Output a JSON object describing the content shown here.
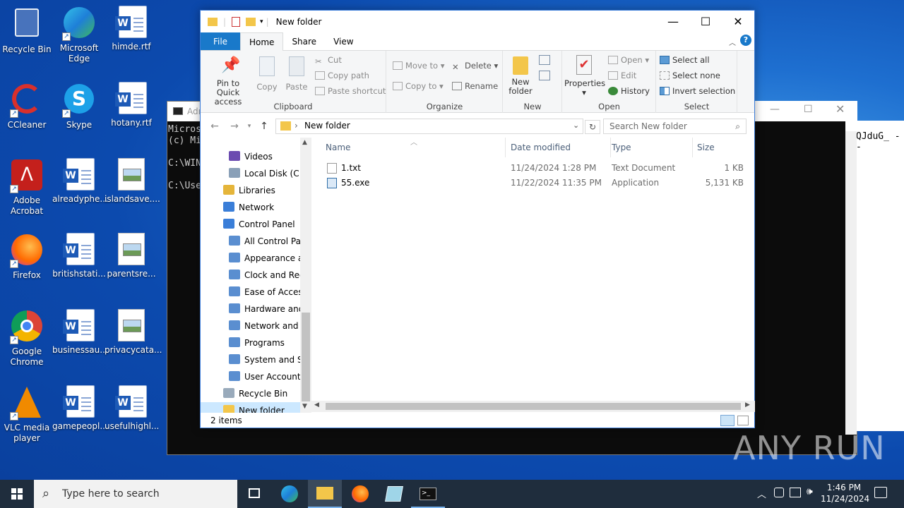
{
  "desktop": {
    "icons": [
      {
        "label": "Recycle Bin",
        "type": "recycle"
      },
      {
        "label": "Microsoft Edge",
        "type": "edge"
      },
      {
        "label": "himde.rtf",
        "type": "word"
      },
      {
        "label": "CCleaner",
        "type": "ccleaner"
      },
      {
        "label": "Skype",
        "type": "skype"
      },
      {
        "label": "hotany.rtf",
        "type": "word"
      },
      {
        "label": "Adobe Acrobat",
        "type": "acrobat"
      },
      {
        "label": "alreadyphe...",
        "type": "word"
      },
      {
        "label": "islandsave....",
        "type": "image"
      },
      {
        "label": "Firefox",
        "type": "firefox"
      },
      {
        "label": "britishstati...",
        "type": "word"
      },
      {
        "label": "parentsre...",
        "type": "image"
      },
      {
        "label": "Google Chrome",
        "type": "chrome"
      },
      {
        "label": "businessau...",
        "type": "word"
      },
      {
        "label": "privacycata...",
        "type": "image"
      },
      {
        "label": "VLC media player",
        "type": "vlc"
      },
      {
        "label": "gamepeopl...",
        "type": "word"
      },
      {
        "label": "usefulhighl...",
        "type": "word"
      }
    ]
  },
  "cmd": {
    "title": "Adı",
    "lines": [
      "Micros",
      "(c) Mi",
      "",
      "C:\\WIN",
      "",
      "C:\\Use"
    ],
    "right_text": "QJduG_ --"
  },
  "explorer": {
    "title": "New folder",
    "tabs": [
      "File",
      "Home",
      "Share",
      "View"
    ],
    "ribbon": {
      "clipboard": {
        "label": "Clipboard",
        "pin": "Pin to Quick access",
        "copy": "Copy",
        "paste": "Paste",
        "cut": "Cut",
        "copy_path": "Copy path",
        "paste_shortcut": "Paste shortcut"
      },
      "organize": {
        "label": "Organize",
        "move_to": "Move to",
        "copy_to": "Copy to",
        "delete": "Delete",
        "rename": "Rename"
      },
      "new": {
        "label": "New",
        "new_folder": "New folder"
      },
      "open": {
        "label": "Open",
        "properties": "Properties",
        "open": "Open",
        "edit": "Edit",
        "history": "History"
      },
      "select": {
        "label": "Select",
        "select_all": "Select all",
        "select_none": "Select none",
        "invert": "Invert selection"
      }
    },
    "address": {
      "path": "New folder",
      "search_placeholder": "Search New folder"
    },
    "nav": [
      {
        "label": "Videos",
        "indent": 1
      },
      {
        "label": "Local Disk (C:)",
        "indent": 1
      },
      {
        "label": "Libraries",
        "indent": 0
      },
      {
        "label": "Network",
        "indent": 0
      },
      {
        "label": "Control Panel",
        "indent": 0
      },
      {
        "label": "All Control Par",
        "indent": 1
      },
      {
        "label": "Appearance an",
        "indent": 1
      },
      {
        "label": "Clock and Regi",
        "indent": 1
      },
      {
        "label": "Ease of Access",
        "indent": 1
      },
      {
        "label": "Hardware and",
        "indent": 1
      },
      {
        "label": "Network and Ir",
        "indent": 1
      },
      {
        "label": "Programs",
        "indent": 1
      },
      {
        "label": "System and Sec",
        "indent": 1
      },
      {
        "label": "User Accounts",
        "indent": 1
      },
      {
        "label": "Recycle Bin",
        "indent": 0
      },
      {
        "label": "New folder",
        "indent": 0,
        "selected": true
      }
    ],
    "columns": {
      "name": "Name",
      "date": "Date modified",
      "type": "Type",
      "size": "Size"
    },
    "files": [
      {
        "name": "1.txt",
        "date": "11/24/2024 1:28 PM",
        "type": "Text Document",
        "size": "1 KB"
      },
      {
        "name": "55.exe",
        "date": "11/22/2024 11:35 PM",
        "type": "Application",
        "size": "5,131 KB"
      }
    ],
    "status": "2 items"
  },
  "taskbar": {
    "search_placeholder": "Type here to search",
    "time": "1:46 PM",
    "date": "11/24/2024"
  },
  "watermark": "ANY RUN"
}
